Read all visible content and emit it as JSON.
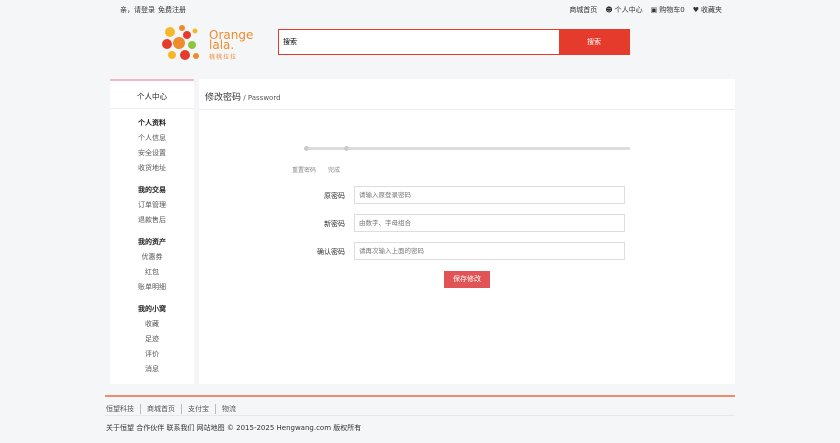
{
  "topbar": {
    "greeting": "亲，请登录",
    "register": "免费注册",
    "links": [
      {
        "icon": "",
        "label": "商城首页"
      },
      {
        "icon": "user-icon",
        "label": "个人中心"
      },
      {
        "icon": "cart-icon",
        "label": "购物车0"
      },
      {
        "icon": "heart-icon",
        "label": "收藏夹"
      }
    ]
  },
  "header": {
    "brand_line1": "Orange",
    "brand_line2": "lala.",
    "brand_sub": "桃桃拉拉",
    "search_value": "搜索",
    "search_button": "搜索"
  },
  "sidebar": {
    "title": "个人中心",
    "groups": [
      {
        "heading": "个人资料",
        "items": [
          "个人信息",
          "安全设置",
          "收货地址"
        ]
      },
      {
        "heading": "我的交易",
        "items": [
          "订单管理",
          "退款售后"
        ]
      },
      {
        "heading": "我的资产",
        "items": [
          "优惠券",
          "红包",
          "账单明细"
        ]
      },
      {
        "heading": "我的小窝",
        "items": [
          "收藏",
          "足迹",
          "评价",
          "消息"
        ]
      }
    ]
  },
  "main": {
    "title": "修改密码",
    "subtitle": "/ Password",
    "steps": [
      "重置密码",
      "完成"
    ],
    "fields": [
      {
        "label": "原密码",
        "placeholder": "请输入原登录密码"
      },
      {
        "label": "新密码",
        "placeholder": "由数字、字母组合"
      },
      {
        "label": "确认密码",
        "placeholder": "请再次输入上面的密码"
      }
    ],
    "submit": "保存修改"
  },
  "footer": {
    "links": [
      "恒望科技",
      "商城首页",
      "支付宝",
      "物流"
    ],
    "copyright": "关于恒望 合作伙伴 联系我们 网站地图 © 2015-2025 Hengwang.com 版权所有"
  },
  "colors": {
    "accent": "#e53b2c",
    "brand": "#f08b2c",
    "submit": "#e05455"
  }
}
